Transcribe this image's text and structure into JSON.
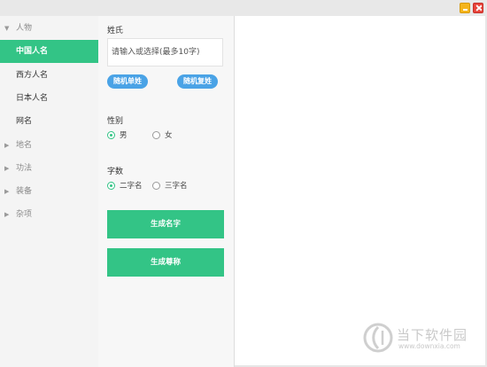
{
  "window": {
    "min_icon": "minimize-icon",
    "close_icon": "close-icon"
  },
  "sidebar": {
    "categories": [
      {
        "label": "人物",
        "expanded": true,
        "items": [
          {
            "label": "中国人名",
            "active": true
          },
          {
            "label": "西方人名",
            "active": false
          },
          {
            "label": "日本人名",
            "active": false
          },
          {
            "label": "网名",
            "active": false
          }
        ]
      },
      {
        "label": "地名",
        "expanded": false
      },
      {
        "label": "功法",
        "expanded": false
      },
      {
        "label": "装备",
        "expanded": false
      },
      {
        "label": "杂项",
        "expanded": false
      }
    ],
    "active_color": "#33c486"
  },
  "form": {
    "surname_label": "姓氏",
    "surname_placeholder": "请输入或选择(最多10字)",
    "surname_value": "",
    "random_single_label": "随机单姓",
    "random_double_label": "随机复姓",
    "gender_label": "性别",
    "gender_options": [
      {
        "label": "男",
        "checked": true
      },
      {
        "label": "女",
        "checked": false
      }
    ],
    "count_label": "字数",
    "count_options": [
      {
        "label": "二字名",
        "checked": true
      },
      {
        "label": "三字名",
        "checked": false
      }
    ],
    "generate_name_label": "生成名字",
    "generate_title_label": "生成尊称"
  },
  "colors": {
    "accent_green": "#33c486",
    "pill_blue": "#4aa3e6"
  },
  "watermark": {
    "name": "当下软件园",
    "url": "www.downxia.com"
  }
}
